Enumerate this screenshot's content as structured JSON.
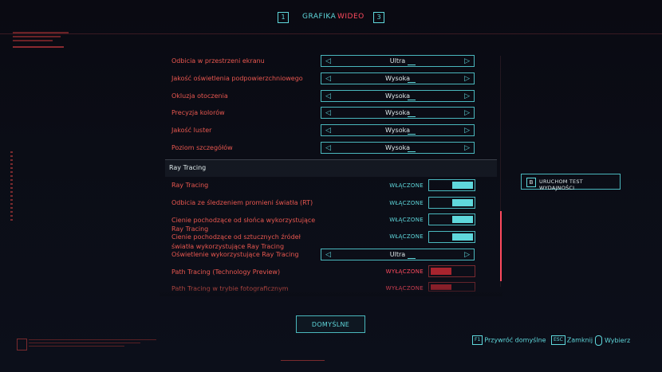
{
  "tabs": {
    "prev_key": "1",
    "next_key": "3",
    "items": [
      "GRAFIKA",
      "WIDEO"
    ]
  },
  "quality_settings": [
    {
      "label": "Odbicia w przestrzeni ekranu",
      "value": "Ultra"
    },
    {
      "label": "Jakość oświetlenia podpowierzchniowego",
      "value": "Wysoka"
    },
    {
      "label": "Okluzja otoczenia",
      "value": "Wysoka"
    },
    {
      "label": "Precyzja kolorów",
      "value": "Wysoka"
    },
    {
      "label": "Jakość luster",
      "value": "Wysoka"
    },
    {
      "label": "Poziom szczegółów",
      "value": "Wysoka"
    }
  ],
  "ray_tracing": {
    "section_title": "Ray Tracing",
    "items": [
      {
        "label": "Ray Tracing",
        "state": "WŁĄCZONE"
      },
      {
        "label": "Odbicia ze śledzeniem promieni światła (RT)",
        "state": "WŁĄCZONE"
      },
      {
        "label_line1": "Cienie pochodzące od słońca wykorzystujące",
        "label_line2": "Ray Tracing",
        "state": "WŁĄCZONE"
      },
      {
        "label_line1": "Cienie pochodzące od sztucznych źródeł",
        "label_line2": "światła wykorzystujące Ray Tracing",
        "state": "WŁĄCZONE"
      },
      {
        "label": "Oświetlenie wykorzystujące Ray Tracing",
        "value": "Ultra"
      },
      {
        "label": "Path Tracing (Technology Preview)",
        "state": "WYŁĄCZONE"
      },
      {
        "label": "Path Tracing w trybie fotograficznym",
        "state": "WYŁĄCZONE"
      }
    ]
  },
  "benchmark": {
    "key": "B",
    "label": "URUCHOM TEST WYDAJNOŚCI"
  },
  "footer": {
    "defaults_label": "DOMYŚLNE",
    "hints": [
      {
        "key": "F1",
        "label": "Przywróć domyślne"
      },
      {
        "key": "ESC",
        "label": "Zamknij"
      },
      {
        "label": "Wybierz"
      }
    ]
  },
  "colors": {
    "accent_cyan": "#5fd8dc",
    "accent_red": "#ff4a5e",
    "label_red": "#e8574f",
    "background": "#0b0c14"
  }
}
